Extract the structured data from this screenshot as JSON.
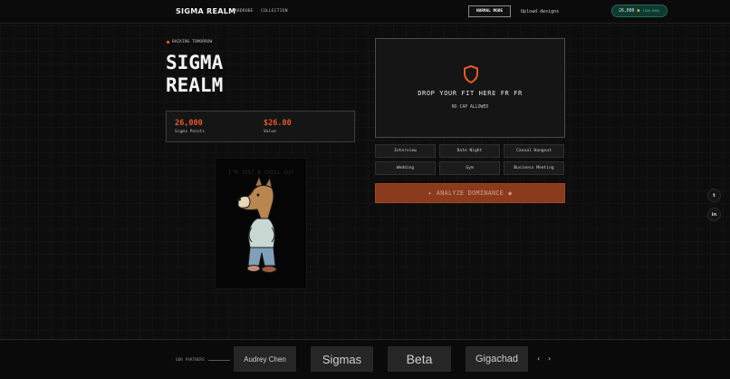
{
  "header": {
    "logo": "SIGMA REALM",
    "nav": [
      "WARDROBE",
      "COLLECTION"
    ],
    "mode_button": "NORMAL MODE",
    "upload_link": "Upload designs",
    "points_pill": {
      "points": "26,000",
      "usd": "($26.000)"
    }
  },
  "hero": {
    "tag": "BACKING TOMORROW",
    "title_line1": "SIGMA",
    "title_line2": "REALM",
    "stats": [
      {
        "value": "26,000",
        "label": "Sigma Points"
      },
      {
        "value": "$26.00",
        "label": "Value"
      }
    ]
  },
  "nft_card": {
    "caption": "I'M JUST A CHILL GUY"
  },
  "drop_zone": {
    "title": "DROP YOUR FIT HERE FR FR",
    "subtitle": "NO CAP ALLOWED",
    "icon": "shield-icon"
  },
  "occasions": [
    "Interview",
    "Date Night",
    "Casual Hangout",
    "Wedding",
    "Gym",
    "Business Meeting"
  ],
  "analyze_button": {
    "label": "ANALYZE DOMINANCE"
  },
  "social": {
    "twitter": "twitter-icon",
    "linkedin": "linkedin-icon"
  },
  "footer": {
    "partners_label": "OUR PARTNERS",
    "partners": [
      "Audrey Chen",
      "Sigmas",
      "Beta",
      "Gigachad"
    ]
  },
  "colors": {
    "accent": "#e5582b",
    "button_bg": "#8a3a1d",
    "pill_bg": "#0f3a2e",
    "pill_text": "#4cc39a"
  }
}
